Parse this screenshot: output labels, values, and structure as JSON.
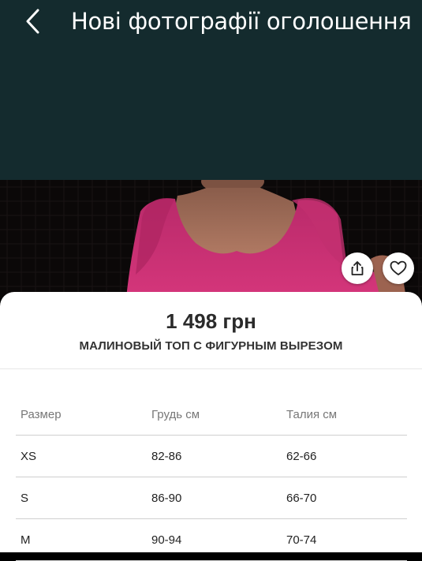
{
  "header": {
    "title": "Нові фотографії оголошення",
    "back_icon": "chevron-left-icon",
    "background": "#142b2e"
  },
  "photo": {
    "accent": "#d2347a",
    "actions": {
      "share_icon": "share-icon",
      "favorite_icon": "heart-outline-icon"
    }
  },
  "product": {
    "price": "1 498 грн",
    "title": "МАЛИНОВЫЙ ТОП С ФИГУРНЫМ ВЫРЕЗОМ"
  },
  "size_table": {
    "headers": [
      "Размер",
      "Грудь см",
      "Талия см"
    ],
    "rows": [
      [
        "XS",
        "82-86",
        "62-66"
      ],
      [
        "S",
        "86-90",
        "66-70"
      ],
      [
        "M",
        "90-94",
        "70-74"
      ]
    ]
  }
}
